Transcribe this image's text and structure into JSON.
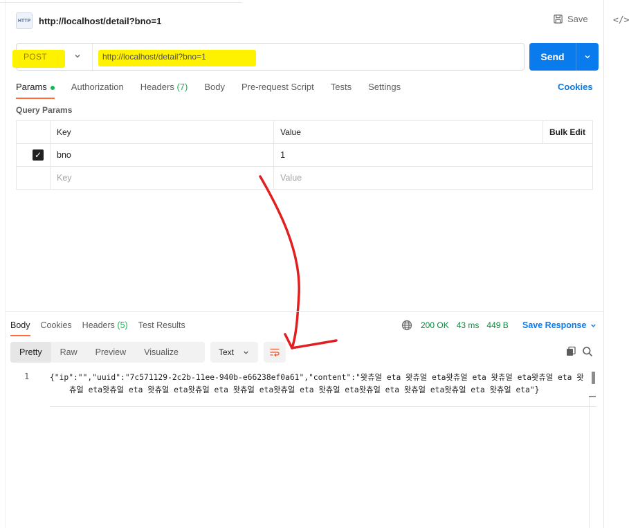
{
  "request": {
    "title": "http://localhost/detail?bno=1",
    "save_label": "Save",
    "method": "POST",
    "url": "http://localhost/detail?bno=1",
    "send_label": "Send",
    "http_badge": "HTTP"
  },
  "request_tabs": [
    {
      "label": "Params",
      "active": true
    },
    {
      "label": "Authorization"
    },
    {
      "label": "Headers",
      "count": "(7)"
    },
    {
      "label": "Body"
    },
    {
      "label": "Pre-request Script"
    },
    {
      "label": "Tests"
    },
    {
      "label": "Settings"
    }
  ],
  "cookies_label": "Cookies",
  "query_params": {
    "title": "Query Params",
    "headers": {
      "key": "Key",
      "value": "Value",
      "bulk": "Bulk Edit"
    },
    "rows": [
      {
        "checked": true,
        "key": "bno",
        "value": "1"
      }
    ],
    "placeholder": {
      "key": "Key",
      "value": "Value"
    }
  },
  "response_tabs": [
    {
      "label": "Body",
      "active": true
    },
    {
      "label": "Cookies"
    },
    {
      "label": "Headers",
      "count": "(5)"
    },
    {
      "label": "Test Results"
    }
  ],
  "response_status": {
    "code": "200 OK",
    "time": "43 ms",
    "size": "449 B"
  },
  "save_response_label": "Save Response",
  "view_modes": [
    "Pretty",
    "Raw",
    "Preview",
    "Visualize"
  ],
  "active_view": "Pretty",
  "format": "Text",
  "code": {
    "line_number": "1",
    "text": "{\"ip\":\"\",\"uuid\":\"7c571129-2c2b-11ee-940b-e66238ef0a61\",\"content\":\"왓츄얼 eta 왓츄얼 eta왓츄얼 eta 왓츄얼 eta왓츄얼 eta 왓츄얼 eta왓츄얼 eta 왓츄얼 eta왓츄얼 eta 왓츄얼 eta왓츄얼 eta 왓츄얼 eta왓츄얼 eta 왓츄얼 eta왓츄얼 eta 왓츄얼 eta\"}"
  },
  "colors": {
    "accent_orange": "#ff6c37",
    "send_blue": "#097bed",
    "status_green": "#0cbb52",
    "highlight_yellow": "#fff200",
    "annotation_red": "#e02020"
  },
  "icons": [
    "http-icon",
    "save-icon",
    "chevron-down-icon",
    "globe-icon",
    "wrap-lines-icon",
    "copy-icon",
    "search-icon",
    "code-icon"
  ]
}
